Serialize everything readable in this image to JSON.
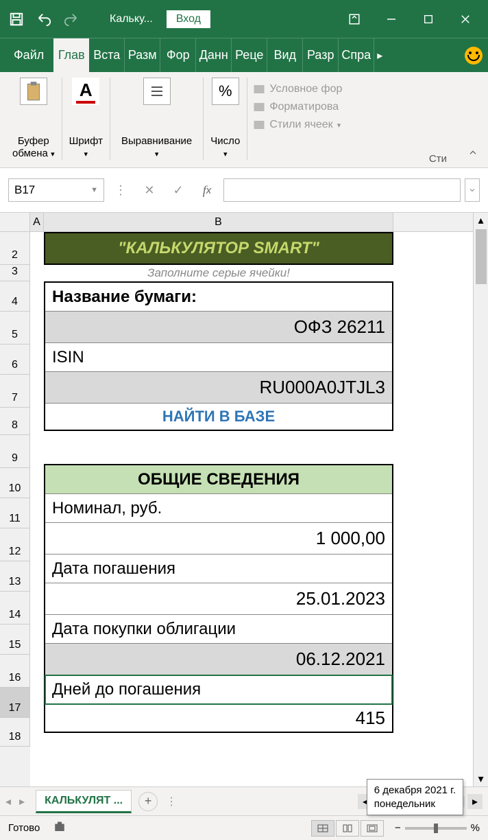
{
  "titlebar": {
    "doc_title": "Кальку...",
    "signin": "Вход"
  },
  "tabs": [
    "Файл",
    "Глав",
    "Вста",
    "Разм",
    "Фор",
    "Данн",
    "Реце",
    "Вид",
    "Разр",
    "Спра"
  ],
  "ribbon": {
    "clipboard": "Буфер\nобмена",
    "font": "Шрифт",
    "alignment": "Выравнивание",
    "number": "Число",
    "percent": "%",
    "cond_format": "Условное фор",
    "format_table": "Форматирова",
    "cell_styles": "Стили ячеек",
    "group_caption": "Сти"
  },
  "formula": {
    "cell_ref": "B17"
  },
  "columns": {
    "A": "A",
    "B": "B"
  },
  "rows": [
    "2",
    "3",
    "4",
    "5",
    "6",
    "7",
    "8",
    "9",
    "10",
    "11",
    "12",
    "13",
    "14",
    "15",
    "16",
    "17",
    "18"
  ],
  "sheet": {
    "title": "\"КАЛЬКУЛЯТОР SMART\"",
    "subtitle": "Заполните серые ячейки!",
    "name_label": "Название бумаги:",
    "name_value": "ОФЗ  26211",
    "isin_label": "ISIN",
    "isin_value": "RU000A0JTJL3",
    "find_link": "НАЙТИ В БАЗЕ",
    "section2": "ОБЩИЕ СВЕДЕНИЯ",
    "nominal_label": "Номинал, руб.",
    "nominal_value": "1 000,00",
    "maturity_label": "Дата погашения",
    "maturity_value": "25.01.2023",
    "purchase_label": "Дата покупки облигации",
    "purchase_value": "06.12.2021",
    "days_label": "Дней до погашения",
    "days_value": "415"
  },
  "sheet_tab": "КАЛЬКУЛЯТ ...",
  "status": {
    "ready": "Готово",
    "zoom": "%"
  },
  "tooltip": {
    "line1": "6 декабря 2021 г.",
    "line2": "понедельник"
  }
}
